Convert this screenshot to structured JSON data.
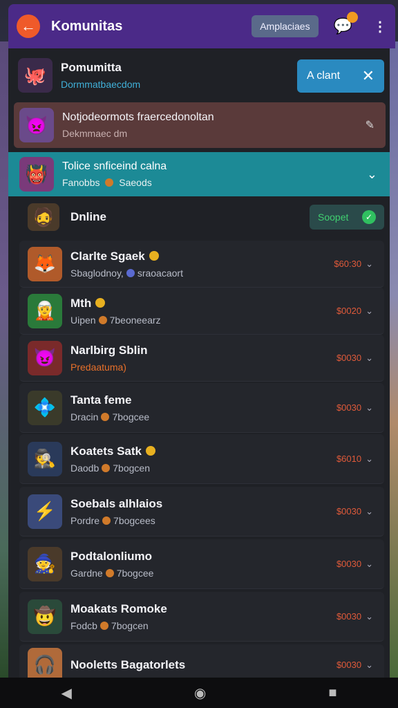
{
  "header": {
    "title": "Komunitas",
    "chip": "Amplaciaes"
  },
  "featured": {
    "name": "Pomumitta",
    "sub": "Dormmatbaecdom",
    "cta_label": "A clant"
  },
  "notice": {
    "name": "Notjodeormots fraercedonoltan",
    "sub": "Dekmmaec dm"
  },
  "selected": {
    "name": "Tolice snficeind calna",
    "sub_left": "Fanobbs",
    "sub_right": "Saeods"
  },
  "online": {
    "label": "Dnline",
    "button": "Soopet"
  },
  "items": [
    {
      "name": "Clarlte Sgaek",
      "sub": "Sbaglodnoy,",
      "sub2": "sraoacaort",
      "price": "$60:30"
    },
    {
      "name": "Mth",
      "sub": "Uipen",
      "sub2": "7beoneearz",
      "price": "$0020"
    },
    {
      "name": "Narlbirg Sblin",
      "sub": "Predaatuma)",
      "sub2": "",
      "price": "$0030"
    },
    {
      "name": "Tanta feme",
      "sub": "Dracin",
      "sub2": "7bogcee",
      "price": "$0030"
    },
    {
      "name": "Koatets Satk",
      "sub": "Daodb",
      "sub2": "7bogcen",
      "price": "$6010"
    },
    {
      "name": "Soebals alhlaios",
      "sub": "Pordre",
      "sub2": "7bogcees",
      "price": "$0030"
    },
    {
      "name": "Podtalonliumo",
      "sub": "Gardne",
      "sub2": "7bogcee",
      "price": "$0030"
    },
    {
      "name": "Moakats Romoke",
      "sub": "Fodcb",
      "sub2": "7bogcen",
      "price": "$0030"
    },
    {
      "name": "Nooletts Bagatorlets",
      "sub": "",
      "sub2": "",
      "price": "$0030"
    }
  ],
  "colors": {
    "header": "#4b2a88",
    "accent": "#1c8a96",
    "price": "#e05a3a"
  }
}
